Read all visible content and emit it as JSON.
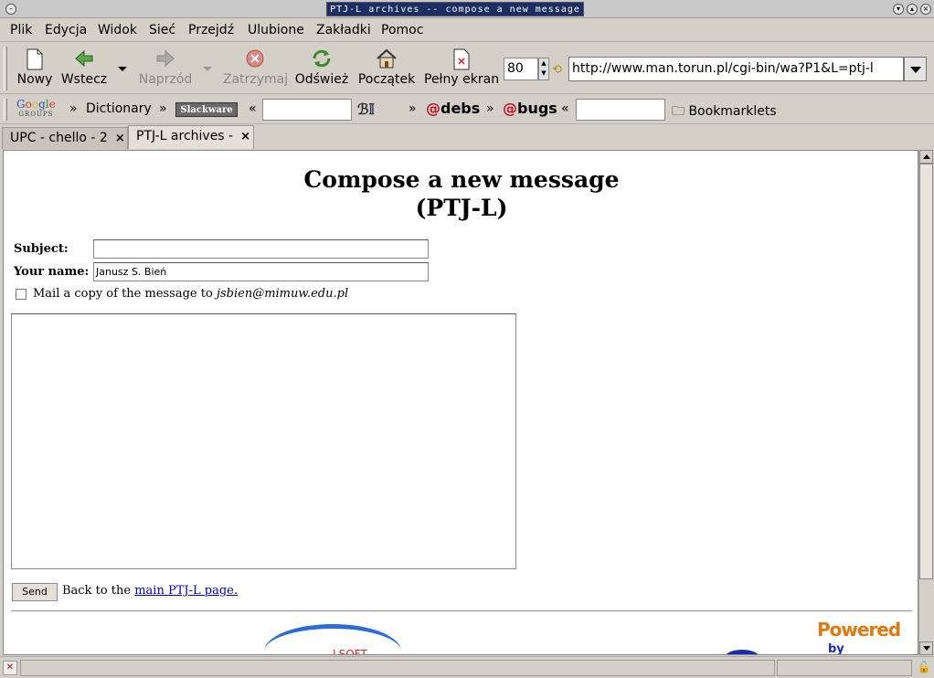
{
  "window": {
    "title": "PTJ-L archives -- compose a new message"
  },
  "menu": {
    "items": [
      "Plik",
      "Edycja",
      "Widok",
      "Sieć",
      "Przejdź",
      "Ulubione",
      "Zakładki",
      "Pomoc"
    ]
  },
  "toolbar": {
    "new_label": "Nowy",
    "back_label": "Wstecz",
    "forward_label": "Naprzód",
    "stop_label": "Zatrzymaj",
    "reload_label": "Odśwież",
    "home_label": "Początek",
    "fullscreen_label": "Pełny ekran",
    "zoom_value": "80",
    "url": "http://www.man.torun.pl/cgi-bin/wa?P1&L=ptj-l"
  },
  "bookmarks": {
    "google_text": "Google",
    "google_sub": "GROUPS",
    "dictionary": "Dictionary",
    "slackware": "Slackware",
    "debs": "debs",
    "bugs": "bugs",
    "bookmarklets": "Bookmarklets",
    "sep_right": "»",
    "sep_left": "«"
  },
  "tabs": [
    {
      "label": "UPC - chello - 2",
      "active": false
    },
    {
      "label": "PTJ-L archives -",
      "active": true
    }
  ],
  "page": {
    "title_line1": "Compose a new message",
    "title_line2": "(PTJ-L)",
    "subject_label": "Subject:",
    "subject_value": "",
    "name_label": "Your name:",
    "name_value": "Janusz S. Bień",
    "copy_text": "Mail a copy of the message to",
    "copy_email": "jsbien@mimuw.edu.pl",
    "copy_checked": false,
    "send_label": "Send",
    "back_text": "Back to the",
    "back_link": "main PTJ-L page.",
    "powered_text": "Powered",
    "powered_by": "by"
  }
}
